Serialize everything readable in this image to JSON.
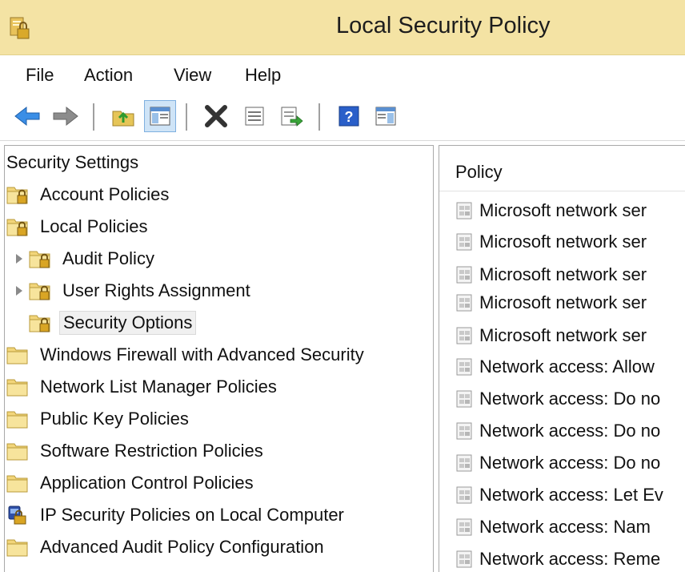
{
  "window": {
    "title": "Local Security Policy"
  },
  "menu": [
    "File",
    "Action",
    "View",
    "Help"
  ],
  "toolbar": {
    "buttons": [
      "back-icon",
      "forward-icon",
      "up-folder-icon",
      "show-hide-tree-icon",
      "delete-icon",
      "properties-icon",
      "export-list-icon",
      "help-icon",
      "action-pane-icon"
    ]
  },
  "tree": {
    "root": "Security Settings",
    "items": [
      {
        "label": "Account Policies",
        "level": 1,
        "icon": "lock-folder-icon"
      },
      {
        "label": "Local Policies",
        "level": 1,
        "icon": "lock-folder-icon"
      },
      {
        "label": "Audit Policy",
        "level": 2,
        "icon": "lock-folder-icon"
      },
      {
        "label": "User Rights Assignment",
        "level": 2,
        "icon": "lock-folder-icon"
      },
      {
        "label": "Security Options",
        "level": 2,
        "icon": "lock-folder-icon"
      },
      {
        "label": "Windows Firewall with Advanced Security",
        "level": 1,
        "icon": "folder-icon"
      },
      {
        "label": "Network List Manager Policies",
        "level": 1,
        "icon": "folder-icon"
      },
      {
        "label": "Public Key Policies",
        "level": 1,
        "icon": "folder-icon"
      },
      {
        "label": "Software Restriction Policies",
        "level": 1,
        "icon": "folder-icon"
      },
      {
        "label": "Application Control Policies",
        "level": 1,
        "icon": "folder-icon"
      },
      {
        "label": "IP Security Policies on Local Computer",
        "level": 1,
        "icon": "ipsec-icon"
      },
      {
        "label": "Advanced Audit Policy Configuration",
        "level": 1,
        "icon": "folder-icon"
      }
    ]
  },
  "list": {
    "column": "Policy",
    "rows": [
      "Microsoft network ser",
      "Microsoft network ser",
      "Microsoft network ser",
      "Microsoft network ser",
      "Microsoft network ser",
      "Network access: Allow",
      "Network access: Do no",
      "Network access: Do no",
      "Network access: Do no",
      "Network access: Let Ev",
      "Network access: Nam",
      "Network access: Reme"
    ]
  }
}
